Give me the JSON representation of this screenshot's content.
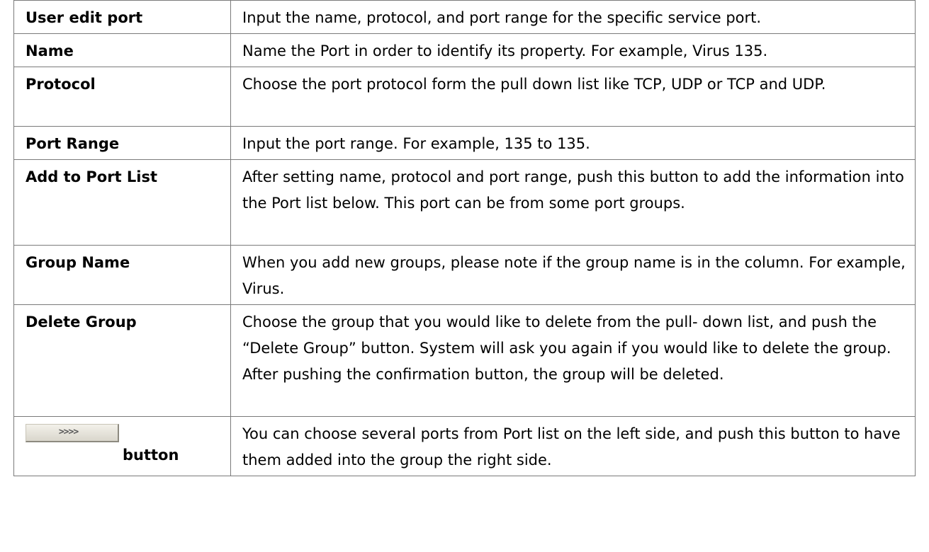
{
  "rows": [
    {
      "term": "User edit port",
      "desc": "Input the name, protocol, and port range for the specific service port."
    },
    {
      "term": "Name",
      "desc": "Name the Port in order to identify its property. For example, Virus 135."
    },
    {
      "term": "Protocol",
      "desc": "Choose the port protocol form the pull down list like TCP, UDP or TCP and UDP."
    },
    {
      "term": "Port Range",
      "desc": "Input the port range. For example, 135 to 135."
    },
    {
      "term": "Add to Port List",
      "desc": "After setting name, protocol and port range, push this button to add the information into the Port list below. This port can be from some port groups."
    },
    {
      "term": "Group Name",
      "desc": "When you add new groups, please note if the group name is in the column. For example, Virus."
    },
    {
      "term": "Delete Group",
      "desc": "Choose the group that you would like to delete from the pull- down list, and push the “Delete Group” button. System will ask you again if you would like to delete the group. After pushing the confirmation button, the group will be deleted."
    },
    {
      "button_glyph": ">>>>",
      "term": "button",
      "desc": "You can choose several ports from Port list on the left side, and push this button to have them added into the group the right side."
    }
  ]
}
